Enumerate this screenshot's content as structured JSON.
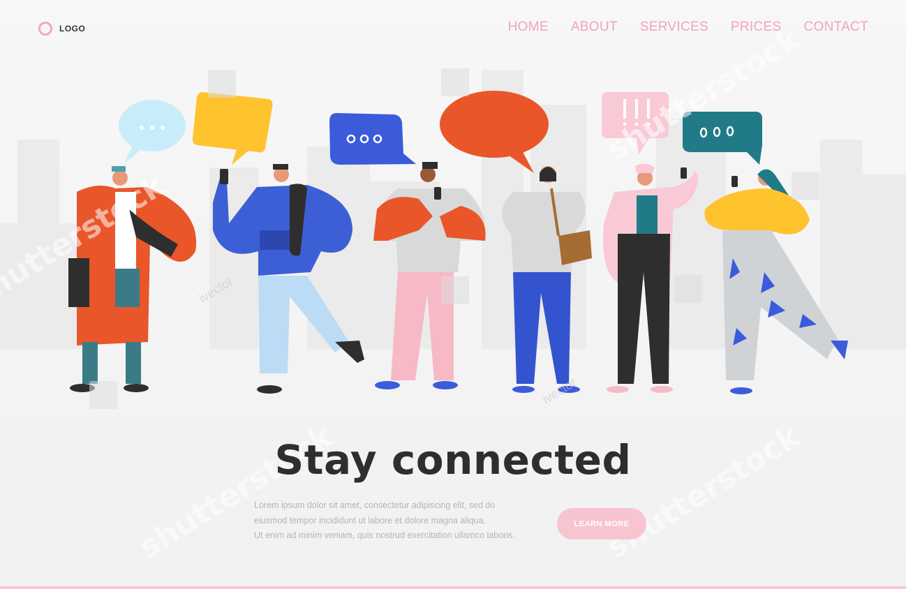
{
  "header": {
    "logo_text": "LOGO",
    "nav": [
      "HOME",
      "ABOUT",
      "SERVICES",
      "PRICES",
      "CONTACT"
    ]
  },
  "hero": {
    "headline": "Stay connected",
    "body_lines": [
      "Lorem ipsum dolor sit amet, consectetur adipiscing elit, sed do",
      "eiusmod tempor incididunt ut labore et dolore magna aliqua.",
      "Ut enim ad minim veniam, quis nostrud exercitation ullamco laboris."
    ],
    "cta_label": "LEARN MORE"
  },
  "watermarks": {
    "brand": "shutterstock",
    "author": "ivector"
  },
  "colors": {
    "accent_pink": "#f4a3b6",
    "button_pink": "#f8c4d0",
    "headline": "#2e2e2e",
    "bubble_light_blue": "#c9ecfb",
    "bubble_yellow": "#fec32d",
    "bubble_blue": "#3b5bdb",
    "bubble_orange": "#e8562a",
    "bubble_pink": "#f9c9d6",
    "bubble_teal": "#217a87"
  }
}
